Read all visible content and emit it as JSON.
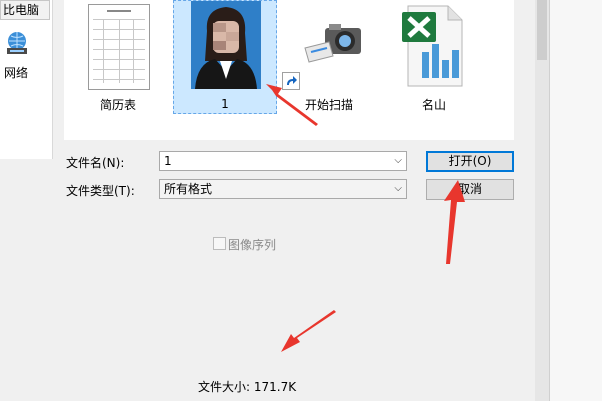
{
  "nav": {
    "this_pc": "比电脑",
    "network": "网络"
  },
  "files": [
    {
      "name": "简历表",
      "type": "document"
    },
    {
      "name": "1",
      "type": "photo",
      "selected": true
    },
    {
      "name": "开始扫描",
      "type": "scanner-shortcut"
    },
    {
      "name": "名山",
      "type": "excel"
    }
  ],
  "form": {
    "filename_label": "文件名(N):",
    "filename_value": "1",
    "filetype_label": "文件类型(T):",
    "filetype_value": "所有格式",
    "open_button": "打开(O)",
    "cancel_button": "取消",
    "image_sequence": "图像序列",
    "image_sequence_checked": false,
    "filesize": "文件大小: 171.7K"
  },
  "colors": {
    "selection": "#cce8ff",
    "annotation_arrow": "#e8362d",
    "default_button_border": "#0078d7"
  }
}
